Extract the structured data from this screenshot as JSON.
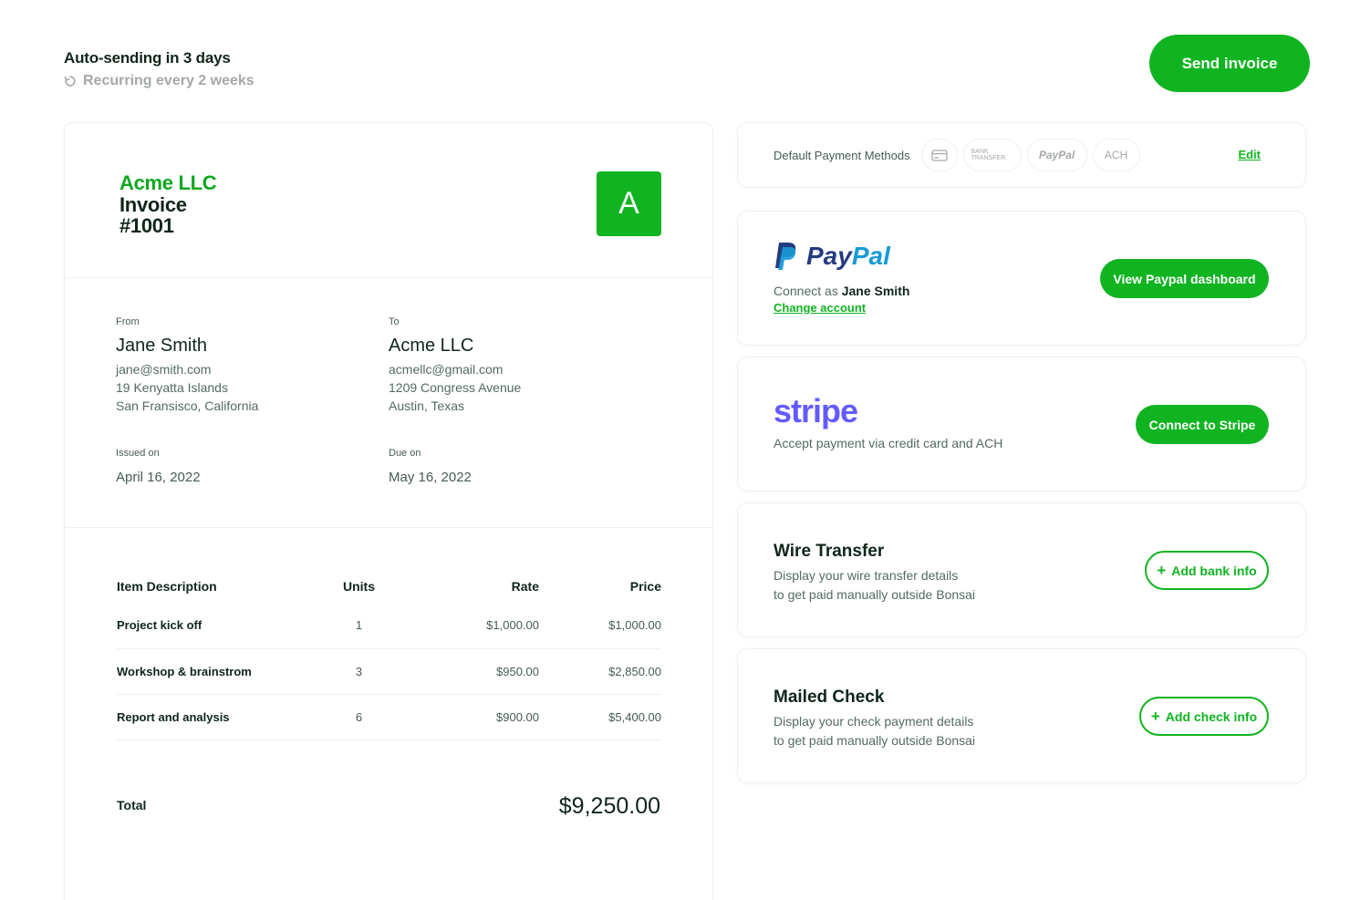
{
  "header": {
    "auto_sending": "Auto-sending in 3 days",
    "recurring": "Recurring every 2 weeks",
    "send_button": "Send invoice"
  },
  "invoice": {
    "company": "Acme LLC",
    "title": "Invoice #1001",
    "logo_letter": "A",
    "from": {
      "label": "From",
      "name": "Jane Smith",
      "email": "jane@smith.com",
      "address1": "19 Kenyatta Islands",
      "address2": "San Fransisco, California"
    },
    "to": {
      "label": "To",
      "name": "Acme LLC",
      "email": "acmellc@gmail.com",
      "address1": "1209 Congress Avenue",
      "address2": "Austin, Texas"
    },
    "issued": {
      "label": "Issued on",
      "value": "April 16, 2022"
    },
    "due": {
      "label": "Due on",
      "value": "May 16, 2022"
    },
    "columns": {
      "desc": "Item Description",
      "units": "Units",
      "rate": "Rate",
      "price": "Price"
    },
    "items": [
      {
        "desc": "Project kick off",
        "units": "1",
        "rate": "$1,000.00",
        "price": "$1,000.00"
      },
      {
        "desc": "Workshop & brainstrom",
        "units": "3",
        "rate": "$950.00",
        "price": "$2,850.00"
      },
      {
        "desc": "Report and analysis",
        "units": "6",
        "rate": "$900.00",
        "price": "$5,400.00"
      }
    ],
    "total_label": "Total",
    "total_value": "$9,250.00"
  },
  "payment_methods": {
    "label": "Default Payment Methods",
    "chips": {
      "card": "card-icon",
      "bank": "BANK TRANSFER",
      "paypal": "PayPal",
      "ach": "ACH"
    },
    "edit": "Edit"
  },
  "paypal": {
    "logo_pay": "Pay",
    "logo_pal": "Pal",
    "connect_prefix": "Connect as ",
    "connect_name": "Jane Smith",
    "change": "Change account",
    "button": "View Paypal dashboard"
  },
  "stripe": {
    "logo": "stripe",
    "desc": "Accept payment via credit card and ACH",
    "button": "Connect to Stripe"
  },
  "wire": {
    "title": "Wire Transfer",
    "line1": "Display your wire transfer details",
    "line2": "to get paid manually outside Bonsai",
    "button": "Add bank info"
  },
  "check": {
    "title": "Mailed Check",
    "line1": "Display your check payment details",
    "line2": "to get paid manually outside Bonsai",
    "button": "Add check info"
  },
  "colors": {
    "brand_green": "#10b421",
    "paypal_navy": "#253b80",
    "paypal_blue": "#179bd7",
    "stripe_purple": "#635bff"
  }
}
